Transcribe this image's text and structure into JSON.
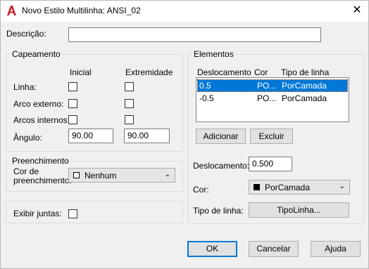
{
  "window": {
    "title": "Novo Estilo Multilinha: ANSI_02",
    "close_glyph": "✕"
  },
  "descricao": {
    "label": "Descrição:",
    "value": ""
  },
  "capeamento": {
    "group_label": "Capeamento",
    "col_inicial": "Inicial",
    "col_extremidade": "Extremidade",
    "rows": [
      {
        "label": "Linha:"
      },
      {
        "label": "Arco externo:"
      },
      {
        "label": "Arcos internos:"
      }
    ],
    "angulo_label": "Ângulo:",
    "angulo_inicial": "90.00",
    "angulo_extremidade": "90.00"
  },
  "preenchimento": {
    "group_label": "Preenchimento",
    "cor_label_1": "Cor de",
    "cor_label_2": "preenchimento:",
    "cor_value": "Nenhum",
    "cor_swatch": "#ffffff"
  },
  "exibir_juntas": {
    "label": "Exibir juntas:",
    "checked": false
  },
  "elementos": {
    "group_label": "Elementos",
    "headers": {
      "deslocamento": "Deslocamento",
      "cor": "Cor",
      "tipo": "Tipo de linha"
    },
    "rows": [
      {
        "deslocamento": "0.5",
        "cor": "PO...",
        "tipo": "PorCamada",
        "selected": true
      },
      {
        "deslocamento": "-0.5",
        "cor": "PO...",
        "tipo": "PorCamada",
        "selected": false
      }
    ],
    "adicionar": "Adicionar",
    "excluir": "Excluir",
    "deslocamento_label": "Deslocamento:",
    "deslocamento_value": "0.500",
    "cor_label": "Cor:",
    "cor_value": "PorCamada",
    "cor_swatch": "#000000",
    "tipo_label": "Tipo de linha:",
    "tipo_button": "TipoLinha..."
  },
  "footer": {
    "ok": "OK",
    "cancelar": "Cancelar",
    "ajuda": "Ajuda"
  },
  "colors": {
    "accent": "#0078d7",
    "app_icon": "#c0272d"
  }
}
